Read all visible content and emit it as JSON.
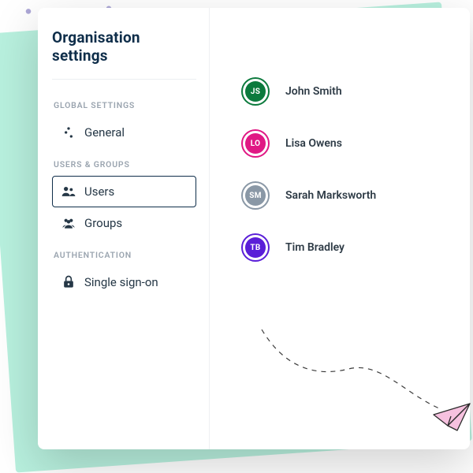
{
  "page_title": "Organisation settings",
  "sections": {
    "global": {
      "header": "GLOBAL SETTINGS",
      "items": {
        "general": "General"
      }
    },
    "users_groups": {
      "header": "USERS & GROUPS",
      "items": {
        "users": "Users",
        "groups": "Groups"
      }
    },
    "auth": {
      "header": "AUTHENTICATION",
      "items": {
        "sso": "Single sign-on"
      }
    }
  },
  "selected_nav": "users",
  "users": [
    {
      "initials": "JS",
      "name": "John Smith",
      "color": "#0c7a3d"
    },
    {
      "initials": "LO",
      "name": "Lisa Owens",
      "color": "#e01884"
    },
    {
      "initials": "SM",
      "name": "Sarah Marksworth",
      "color": "#8a98a6"
    },
    {
      "initials": "TB",
      "name": "Tim Bradley",
      "color": "#5a1ed8"
    }
  ]
}
